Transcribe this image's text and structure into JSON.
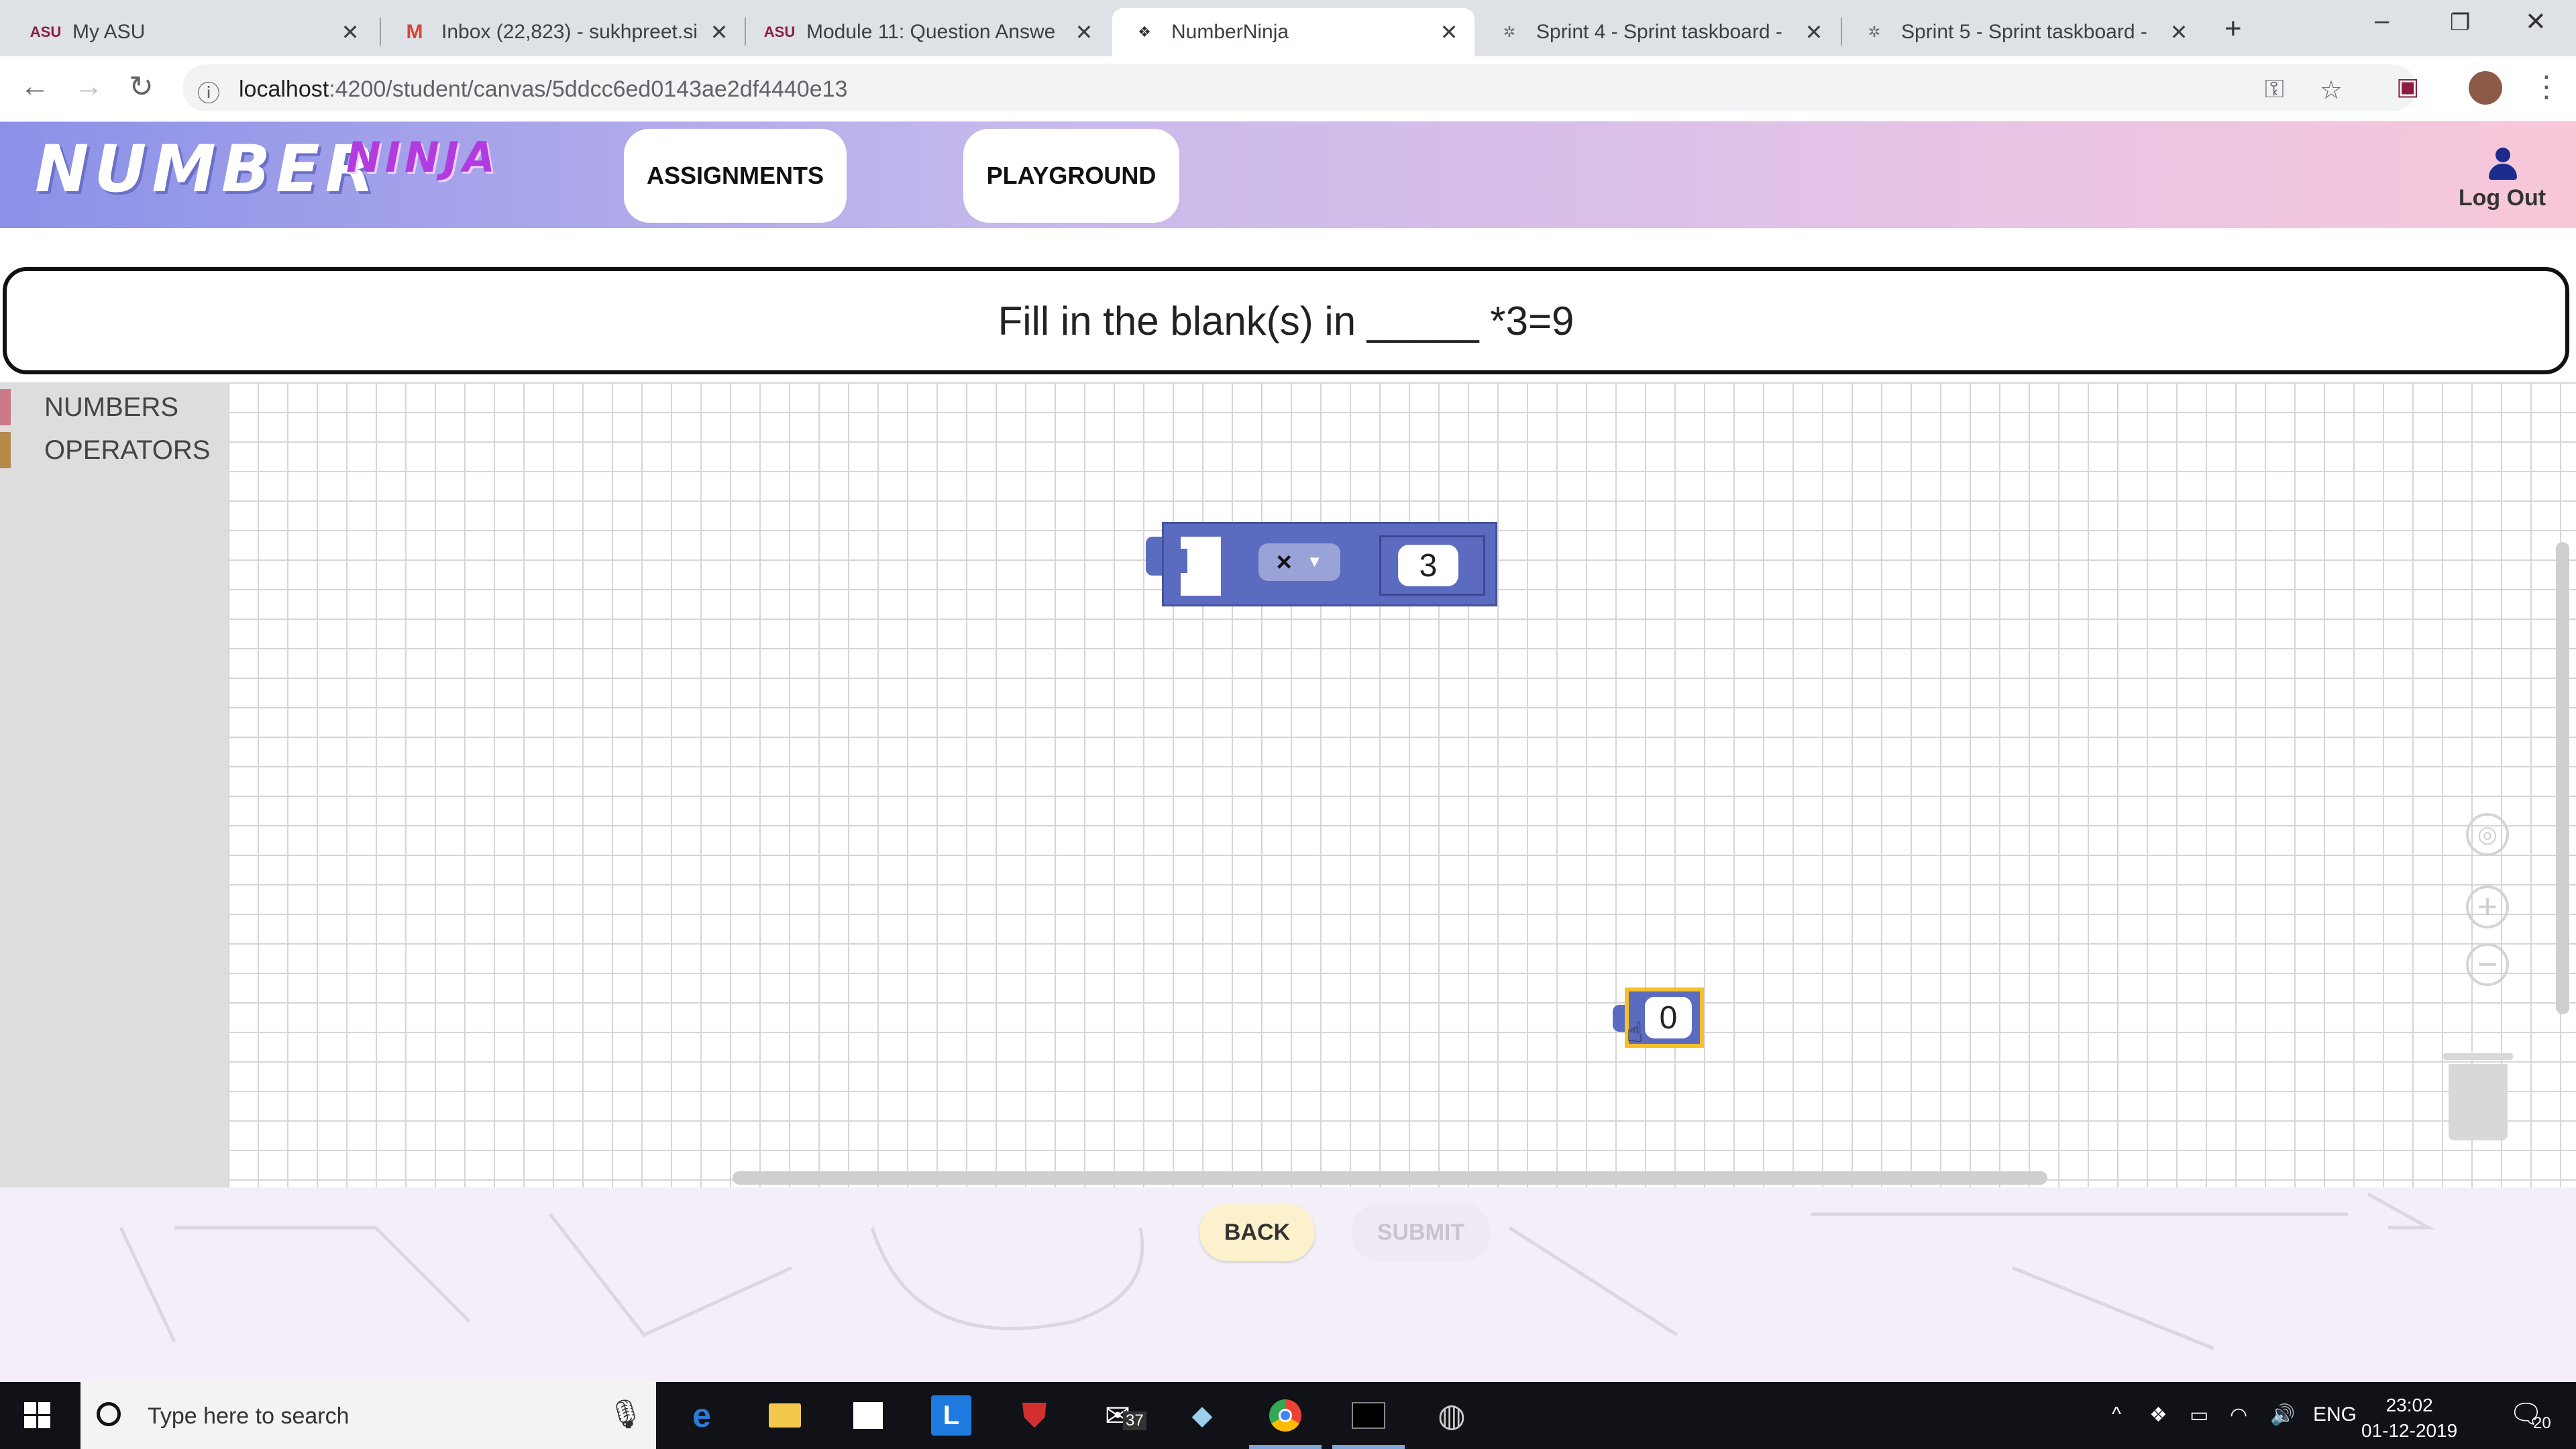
{
  "browser": {
    "tabs": [
      {
        "title": "My ASU",
        "favicon": "asu-logo-icon"
      },
      {
        "title": "Inbox (22,823) - sukhpreet.si",
        "favicon": "gmail-icon"
      },
      {
        "title": "Module 11: Question Answe",
        "favicon": "asu-logo-icon"
      },
      {
        "title": "NumberNinja",
        "favicon": "numberninja-icon",
        "active": true
      },
      {
        "title": "Sprint 4 - Sprint taskboard -",
        "favicon": "taskboard-icon"
      },
      {
        "title": "Sprint 5 - Sprint taskboard -",
        "favicon": "taskboard-icon"
      }
    ],
    "url_host": "localhost",
    "url_path": ":4200/student/canvas/5ddcc6ed0143ae2df4440e13"
  },
  "header": {
    "logo_main": "NUMBER",
    "logo_sub": "NINJA",
    "nav": {
      "assignments": "ASSIGNMENTS",
      "playground": "PLAYGROUND"
    },
    "logout_label": "Log Out"
  },
  "question": {
    "text": "Fill in the blank(s) in _____ *3=9"
  },
  "toolbox": {
    "categories": [
      {
        "label": "NUMBERS",
        "color": "#c97a86"
      },
      {
        "label": "OPERATORS",
        "color": "#b38a4a"
      }
    ]
  },
  "workspace": {
    "multiply_block": {
      "operator": "×",
      "right_value": "3"
    },
    "number_block": {
      "value": "0"
    },
    "block_color": "#5b6bbf",
    "selected_outline_color": "#f6c02a"
  },
  "footer": {
    "back_label": "BACK",
    "submit_label": "SUBMIT"
  },
  "taskbar": {
    "search_placeholder": "Type here to search",
    "mail_badge": "37",
    "language": "ENG",
    "time": "23:02",
    "date": "01-12-2019",
    "notifications": "20"
  }
}
